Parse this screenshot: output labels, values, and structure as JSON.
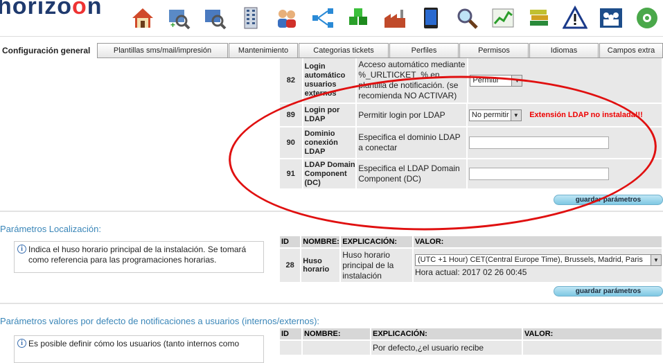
{
  "header": {
    "logo": {
      "part1": "h",
      "part2": "orizo",
      "part3": "o",
      "part4": "n"
    },
    "icons": [
      "home-icon",
      "asset-search-icon",
      "search-ticket-icon",
      "building-icon",
      "users-icon",
      "network-icon",
      "cubes-icon",
      "factory-icon",
      "tablet-icon",
      "magnifier-icon",
      "chart-icon",
      "books-icon",
      "warning-icon",
      "team-icon",
      "settings-gear-icon"
    ]
  },
  "tabs": [
    "Configuración general",
    "Plantillas sms/mail/impresión",
    "Mantenimiento",
    "Categorias tickets",
    "Perfiles",
    "Permisos",
    "Idiomas",
    "Campos extra"
  ],
  "config_rows": [
    {
      "id": "82",
      "name": "Login automático usuarios externos",
      "expl": "Acceso automático mediante %_URLTICKET_% en plantilla de notificación. (se recomienda NO ACTIVAR)",
      "value": "Permitir",
      "kind": "select"
    },
    {
      "id": "89",
      "name": "Login por LDAP",
      "expl": "Permitir login por LDAP",
      "value": "No permitir",
      "kind": "select",
      "warning": "Extensión LDAP no instalada!!!"
    },
    {
      "id": "90",
      "name": "Dominio conexión LDAP",
      "expl": "Especifica el dominio LDAP a conectar",
      "value": "",
      "kind": "text"
    },
    {
      "id": "91",
      "name": "LDAP Domain Component (DC)",
      "expl": "Especifica el LDAP Domain Component (DC)",
      "value": "",
      "kind": "text"
    }
  ],
  "save_label": "guardar parámetros",
  "localization": {
    "title": "Parámetros Localización:",
    "info": "Indica el huso horario principal de la instalación. Se tomará como referencia para las programaciones horarias.",
    "headers": [
      "ID",
      "NOMBRE:",
      "EXPLICACIÓN:",
      "VALOR:"
    ],
    "row": {
      "id": "28",
      "name": "Huso horario",
      "expl": "Huso horario principal de la instalación",
      "value": "(UTC +1 Hour) CET(Central Europe Time), Brussels, Madrid, Paris",
      "current": "Hora actual: 2017 02 26 00:45"
    }
  },
  "notifications": {
    "title": "Parámetros valores por defecto de notificaciones a usuarios (internos/externos):",
    "info": "Es posible definir cómo los usuarios (tanto internos como",
    "headers": [
      "ID",
      "NOMBRE:",
      "EXPLICACIÓN:",
      "VALOR:"
    ],
    "row_expl": "Por defecto,¿el usuario recibe"
  }
}
